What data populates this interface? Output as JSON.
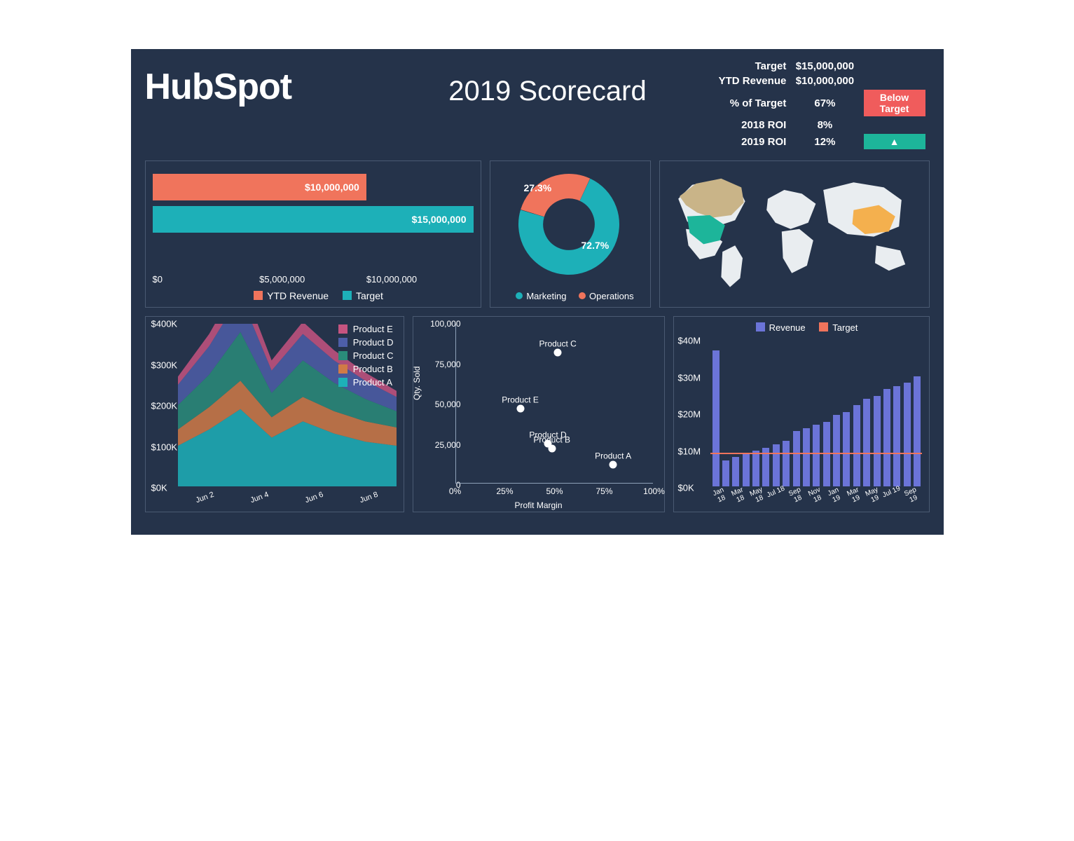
{
  "header": {
    "logo_text": "HubSpot",
    "title": "2019 Scorecard"
  },
  "kpis": {
    "rows": [
      {
        "label": "Target",
        "value": "$15,000,000",
        "badge": ""
      },
      {
        "label": "YTD Revenue",
        "value": "$10,000,000",
        "badge": ""
      },
      {
        "label": "% of Target",
        "value": "67%",
        "badge": "Below Target",
        "badge_class": "badge-red"
      },
      {
        "label": "2018 ROI",
        "value": "8%",
        "badge": ""
      },
      {
        "label": "2019 ROI",
        "value": "12%",
        "badge": "▲",
        "badge_class": "badge-green"
      }
    ]
  },
  "chart_data": [
    {
      "id": "target_vs_revenue",
      "type": "bar",
      "orientation": "horizontal",
      "series": [
        {
          "name": "YTD Revenue",
          "value": 10000000,
          "label": "$10,000,000",
          "color": "#f0745c"
        },
        {
          "name": "Target",
          "value": 15000000,
          "label": "$15,000,000",
          "color": "#1db0b8"
        }
      ],
      "xticks": [
        "$0",
        "$5,000,000",
        "$10,000,000"
      ],
      "xlim": [
        0,
        15000000
      ],
      "legend": [
        "YTD Revenue",
        "Target"
      ]
    },
    {
      "id": "spend_split",
      "type": "pie",
      "slices": [
        {
          "name": "Marketing",
          "value": 72.7,
          "label": "72.7%",
          "color": "#1db0b8"
        },
        {
          "name": "Operations",
          "value": 27.3,
          "label": "27.3%",
          "color": "#f0745c"
        }
      ]
    },
    {
      "id": "world_map",
      "type": "map",
      "highlighted_regions": [
        {
          "region": "Canada",
          "color": "#c9b488"
        },
        {
          "region": "United States",
          "color": "#1db59a"
        },
        {
          "region": "China",
          "color": "#f4b04e"
        }
      ]
    },
    {
      "id": "product_area",
      "type": "area",
      "x": [
        "Jun 2",
        "Jun 4",
        "Jun 6",
        "Jun 8"
      ],
      "yticks": [
        "$0K",
        "$100K",
        "$200K",
        "$300K",
        "$400K"
      ],
      "ylim": [
        0,
        400000
      ],
      "series": [
        {
          "name": "Product A",
          "color": "#1db0b8",
          "values": [
            100000,
            140000,
            190000,
            120000,
            160000,
            130000,
            110000,
            100000
          ]
        },
        {
          "name": "Product B",
          "color": "#d07a46",
          "values": [
            40000,
            55000,
            70000,
            50000,
            60000,
            55000,
            50000,
            45000
          ]
        },
        {
          "name": "Product C",
          "color": "#2a8c7a",
          "values": [
            60000,
            80000,
            120000,
            60000,
            90000,
            70000,
            55000,
            40000
          ]
        },
        {
          "name": "Product D",
          "color": "#4d5ea8",
          "values": [
            50000,
            70000,
            90000,
            55000,
            65000,
            55000,
            45000,
            35000
          ]
        },
        {
          "name": "Product E",
          "color": "#c55480",
          "values": [
            20000,
            30000,
            40000,
            25000,
            30000,
            25000,
            20000,
            15000
          ]
        }
      ]
    },
    {
      "id": "margin_scatter",
      "type": "scatter",
      "xlabel": "Profit Margin",
      "ylabel": "Qty. Sold",
      "xlim": [
        0,
        100
      ],
      "xticks": [
        "0%",
        "25%",
        "50%",
        "75%",
        "100%"
      ],
      "ylim": [
        0,
        100000
      ],
      "yticks": [
        "0",
        "25,000",
        "50,000",
        "75,000",
        "100,000"
      ],
      "points": [
        {
          "name": "Product A",
          "x": 80,
          "y": 12000
        },
        {
          "name": "Product B",
          "x": 49,
          "y": 22000
        },
        {
          "name": "Product C",
          "x": 52,
          "y": 82000
        },
        {
          "name": "Product D",
          "x": 47,
          "y": 25000
        },
        {
          "name": "Product E",
          "x": 33,
          "y": 47000
        }
      ]
    },
    {
      "id": "monthly_columns",
      "type": "bar",
      "legend": [
        "Revenue",
        "Target"
      ],
      "yticks": [
        "$0K",
        "$10M",
        "$20M",
        "$30M",
        "$40M"
      ],
      "ylim": [
        0,
        45
      ],
      "target": 10,
      "categories": [
        "Jan 18",
        "Feb 18",
        "Mar 18",
        "Apr 18",
        "May 18",
        "Jun 18",
        "Jul 18",
        "Aug 18",
        "Sep 18",
        "Oct 18",
        "Nov 18",
        "Dec 18",
        "Jan 19",
        "Feb 19",
        "Mar 19",
        "Apr 19",
        "May 19",
        "Jun 19",
        "Jul 19",
        "Aug 19",
        "Sep 19"
      ],
      "xlabels": [
        "Jan 18",
        "Mar 18",
        "May 18",
        "Jul 18",
        "Sep 18",
        "Nov 18",
        "Jan 19",
        "Mar 19",
        "May 19",
        "Jul 19",
        "Sep 19"
      ],
      "values": [
        42,
        8,
        9,
        10,
        11,
        12,
        13,
        14,
        17,
        18,
        19,
        20,
        22,
        23,
        25,
        27,
        28,
        30,
        31,
        32,
        34
      ]
    }
  ]
}
